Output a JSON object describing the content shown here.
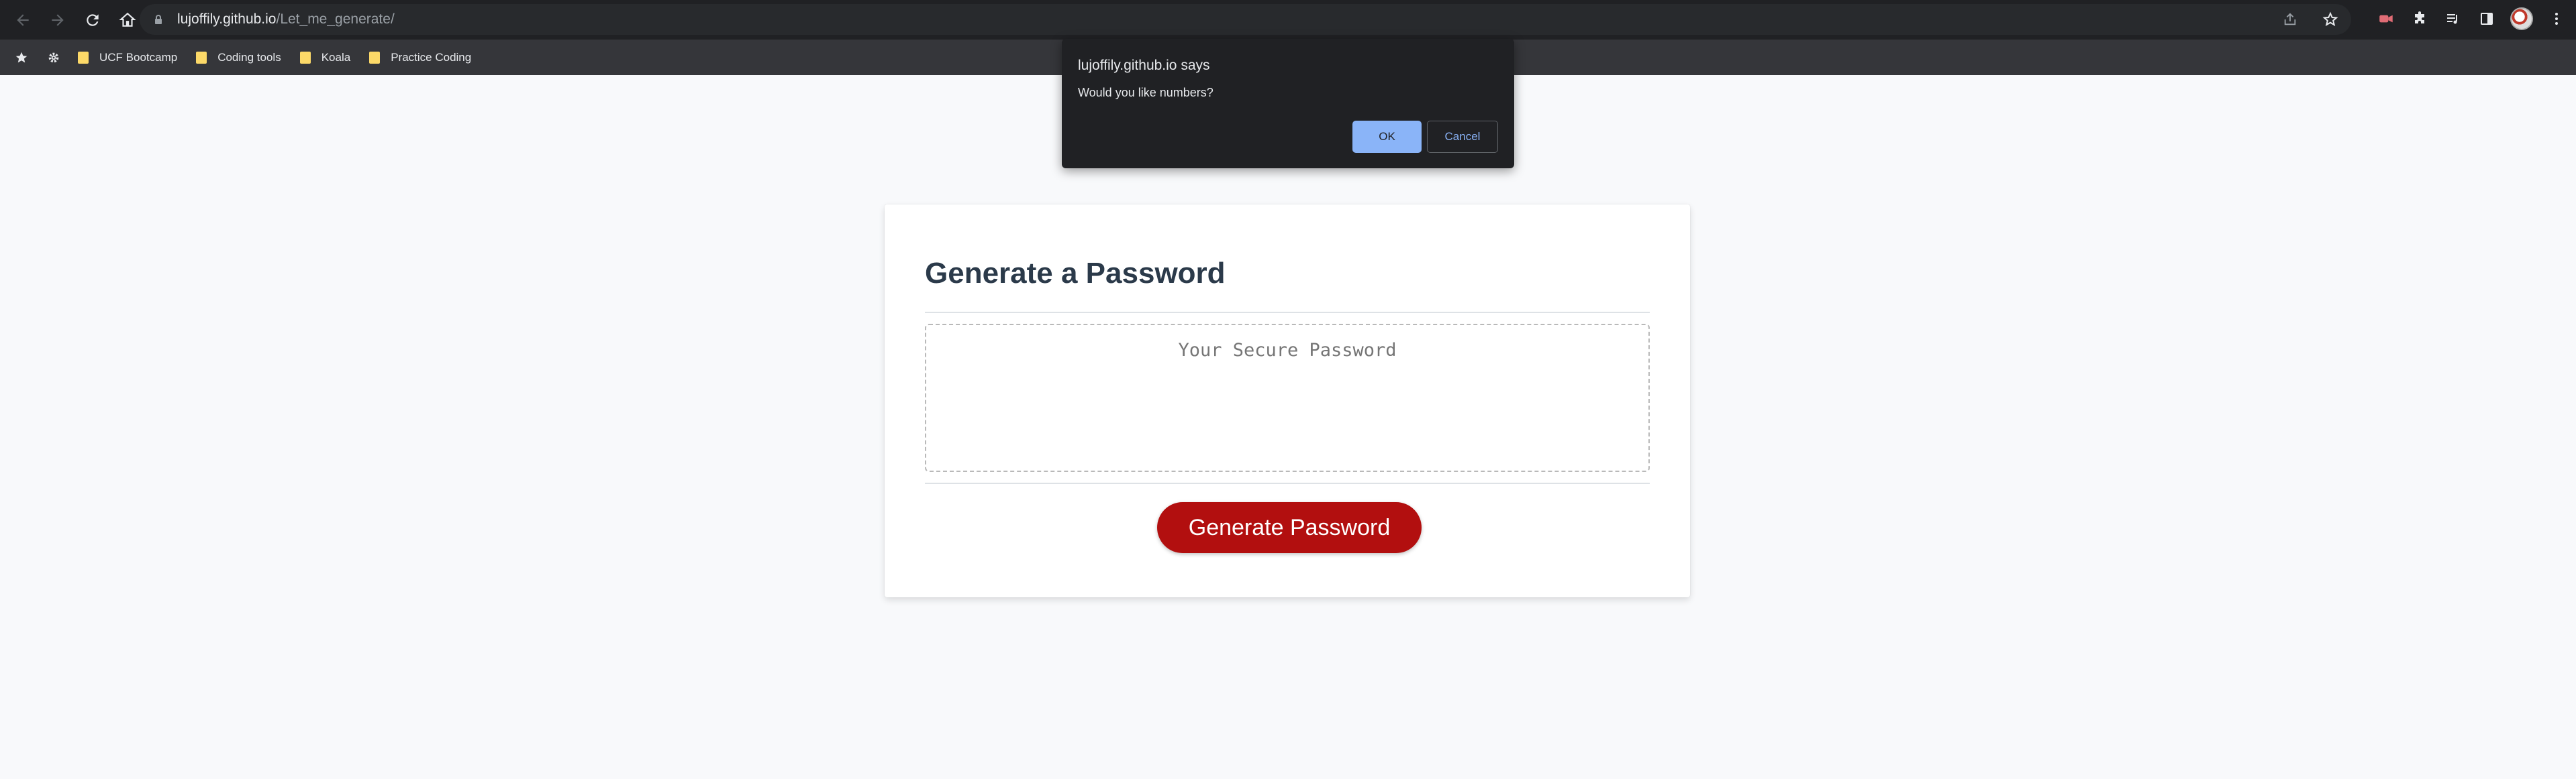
{
  "browser": {
    "url_host": "lujoffily.github.io",
    "url_path": "/Let_me_generate/",
    "bookmarks": [
      {
        "label": "UCF Bootcamp"
      },
      {
        "label": "Coding tools"
      },
      {
        "label": "Koala"
      },
      {
        "label": "Practice Coding"
      }
    ]
  },
  "page": {
    "title": "Generate a Password",
    "password_placeholder": "Your Secure Password",
    "generate_label": "Generate Password",
    "accent_color": "#b20f0f"
  },
  "dialog": {
    "title": "lujoffily.github.io says",
    "message": "Would you like numbers?",
    "ok_label": "OK",
    "cancel_label": "Cancel"
  }
}
